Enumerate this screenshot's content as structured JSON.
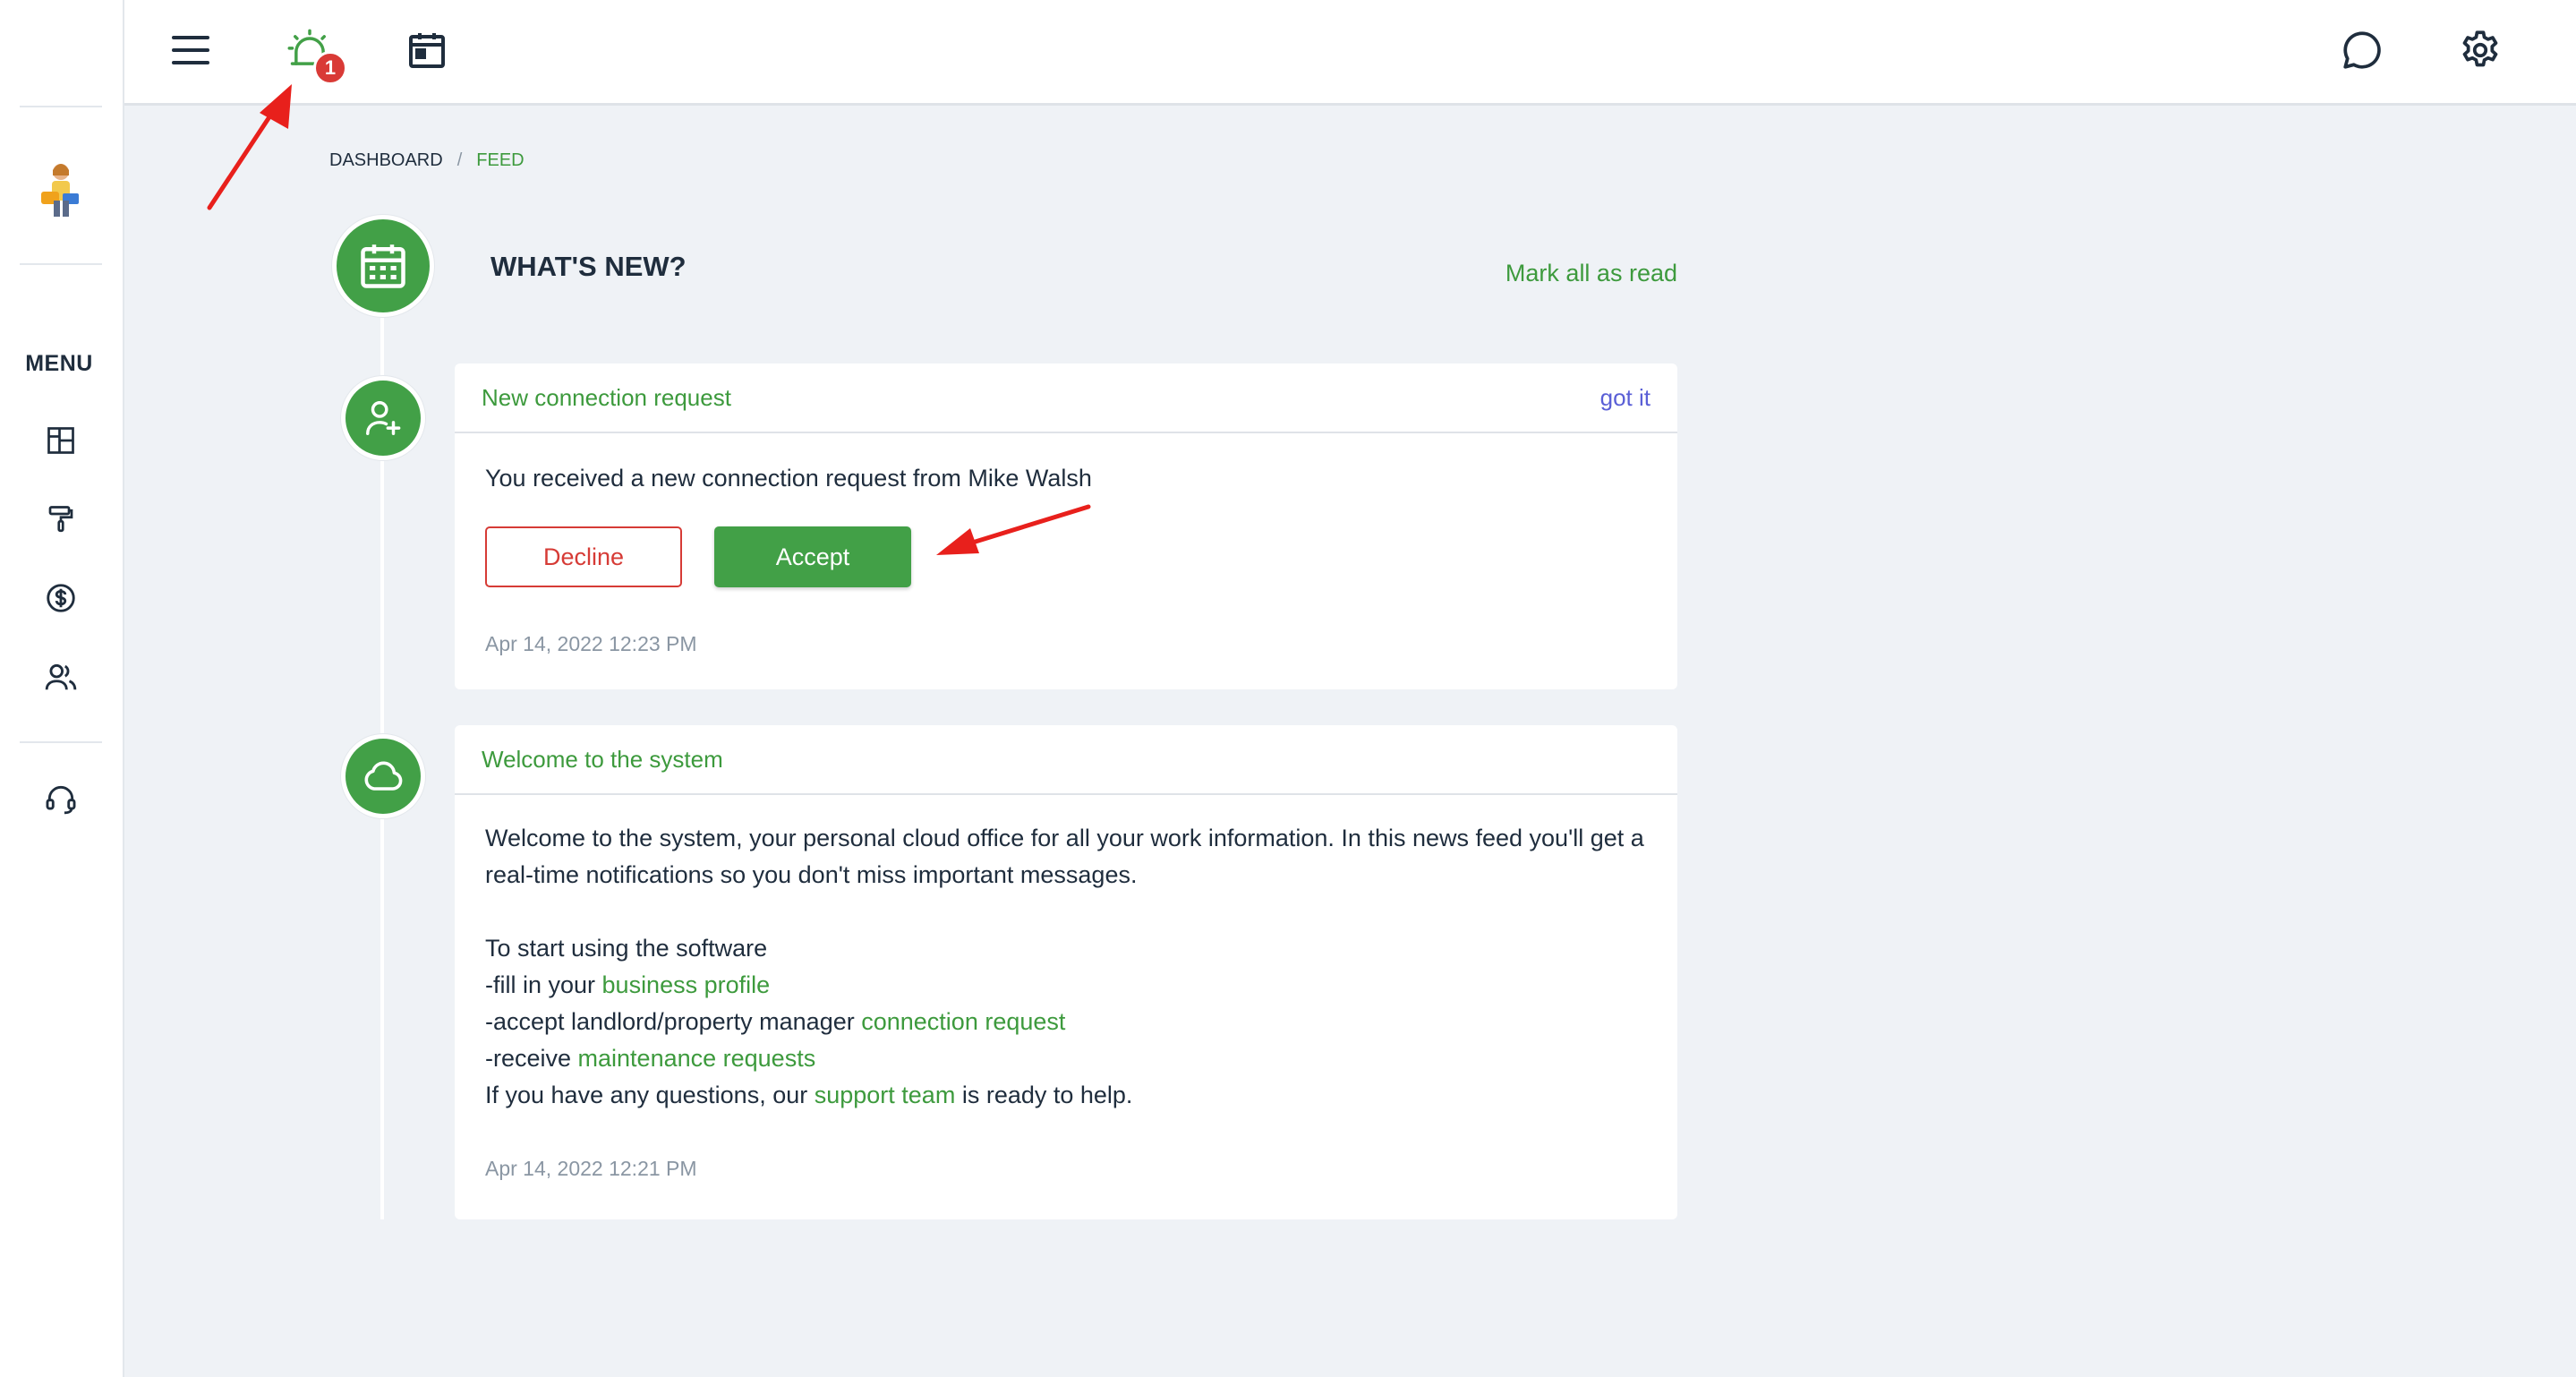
{
  "sidebar": {
    "menu_label": "MENU",
    "icons": [
      "layout-icon",
      "paint-roller-icon",
      "dollar-icon",
      "users-icon",
      "headset-icon"
    ]
  },
  "topbar": {
    "left_icons": [
      "hamburger-icon",
      "alarm-bell-icon",
      "calendar-icon"
    ],
    "notification_count": "1",
    "right_icons": [
      "chat-icon",
      "gear-icon"
    ]
  },
  "breadcrumb": {
    "home": "DASHBOARD",
    "separator": "/",
    "current": "FEED"
  },
  "feed": {
    "title": "WHAT'S NEW?",
    "mark_all_read": "Mark all as read",
    "items": [
      {
        "title": "New connection request",
        "dismiss": "got it",
        "message": "You received a new connection request from Mike Walsh",
        "decline_label": "Decline",
        "accept_label": "Accept",
        "date": "Apr 14, 2022 12:23 PM"
      },
      {
        "title": "Welcome to the system",
        "intro": "Welcome to the system, your personal cloud office for all your work information. In this news feed you'll get a real-time notifications so you don't miss important messages.",
        "start_line": "To start using the software",
        "step1_prefix": "-fill in your ",
        "step1_link": "business profile",
        "step2_prefix": "-accept landlord/property manager ",
        "step2_link": "connection request",
        "step3_prefix": "-receive ",
        "step3_link": "maintenance requests",
        "help_prefix": "If you have any questions, our ",
        "help_link": "support team",
        "help_suffix": " is ready to help.",
        "date": "Apr 14, 2022 12:21 PM"
      }
    ]
  },
  "colors": {
    "accent_green": "#42a047",
    "decline_red": "#d63b36",
    "link_purple": "#5a5fd6",
    "annotation_red": "#e8201c"
  }
}
